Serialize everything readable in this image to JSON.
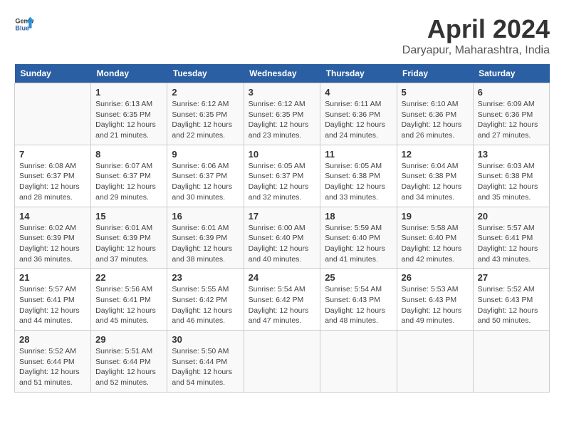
{
  "header": {
    "logo_general": "General",
    "logo_blue": "Blue",
    "month_title": "April 2024",
    "location": "Daryapur, Maharashtra, India"
  },
  "columns": [
    "Sunday",
    "Monday",
    "Tuesday",
    "Wednesday",
    "Thursday",
    "Friday",
    "Saturday"
  ],
  "weeks": [
    [
      {
        "day": "",
        "info": ""
      },
      {
        "day": "1",
        "info": "Sunrise: 6:13 AM\nSunset: 6:35 PM\nDaylight: 12 hours\nand 21 minutes."
      },
      {
        "day": "2",
        "info": "Sunrise: 6:12 AM\nSunset: 6:35 PM\nDaylight: 12 hours\nand 22 minutes."
      },
      {
        "day": "3",
        "info": "Sunrise: 6:12 AM\nSunset: 6:35 PM\nDaylight: 12 hours\nand 23 minutes."
      },
      {
        "day": "4",
        "info": "Sunrise: 6:11 AM\nSunset: 6:36 PM\nDaylight: 12 hours\nand 24 minutes."
      },
      {
        "day": "5",
        "info": "Sunrise: 6:10 AM\nSunset: 6:36 PM\nDaylight: 12 hours\nand 26 minutes."
      },
      {
        "day": "6",
        "info": "Sunrise: 6:09 AM\nSunset: 6:36 PM\nDaylight: 12 hours\nand 27 minutes."
      }
    ],
    [
      {
        "day": "7",
        "info": "Sunrise: 6:08 AM\nSunset: 6:37 PM\nDaylight: 12 hours\nand 28 minutes."
      },
      {
        "day": "8",
        "info": "Sunrise: 6:07 AM\nSunset: 6:37 PM\nDaylight: 12 hours\nand 29 minutes."
      },
      {
        "day": "9",
        "info": "Sunrise: 6:06 AM\nSunset: 6:37 PM\nDaylight: 12 hours\nand 30 minutes."
      },
      {
        "day": "10",
        "info": "Sunrise: 6:05 AM\nSunset: 6:37 PM\nDaylight: 12 hours\nand 32 minutes."
      },
      {
        "day": "11",
        "info": "Sunrise: 6:05 AM\nSunset: 6:38 PM\nDaylight: 12 hours\nand 33 minutes."
      },
      {
        "day": "12",
        "info": "Sunrise: 6:04 AM\nSunset: 6:38 PM\nDaylight: 12 hours\nand 34 minutes."
      },
      {
        "day": "13",
        "info": "Sunrise: 6:03 AM\nSunset: 6:38 PM\nDaylight: 12 hours\nand 35 minutes."
      }
    ],
    [
      {
        "day": "14",
        "info": "Sunrise: 6:02 AM\nSunset: 6:39 PM\nDaylight: 12 hours\nand 36 minutes."
      },
      {
        "day": "15",
        "info": "Sunrise: 6:01 AM\nSunset: 6:39 PM\nDaylight: 12 hours\nand 37 minutes."
      },
      {
        "day": "16",
        "info": "Sunrise: 6:01 AM\nSunset: 6:39 PM\nDaylight: 12 hours\nand 38 minutes."
      },
      {
        "day": "17",
        "info": "Sunrise: 6:00 AM\nSunset: 6:40 PM\nDaylight: 12 hours\nand 40 minutes."
      },
      {
        "day": "18",
        "info": "Sunrise: 5:59 AM\nSunset: 6:40 PM\nDaylight: 12 hours\nand 41 minutes."
      },
      {
        "day": "19",
        "info": "Sunrise: 5:58 AM\nSunset: 6:40 PM\nDaylight: 12 hours\nand 42 minutes."
      },
      {
        "day": "20",
        "info": "Sunrise: 5:57 AM\nSunset: 6:41 PM\nDaylight: 12 hours\nand 43 minutes."
      }
    ],
    [
      {
        "day": "21",
        "info": "Sunrise: 5:57 AM\nSunset: 6:41 PM\nDaylight: 12 hours\nand 44 minutes."
      },
      {
        "day": "22",
        "info": "Sunrise: 5:56 AM\nSunset: 6:41 PM\nDaylight: 12 hours\nand 45 minutes."
      },
      {
        "day": "23",
        "info": "Sunrise: 5:55 AM\nSunset: 6:42 PM\nDaylight: 12 hours\nand 46 minutes."
      },
      {
        "day": "24",
        "info": "Sunrise: 5:54 AM\nSunset: 6:42 PM\nDaylight: 12 hours\nand 47 minutes."
      },
      {
        "day": "25",
        "info": "Sunrise: 5:54 AM\nSunset: 6:43 PM\nDaylight: 12 hours\nand 48 minutes."
      },
      {
        "day": "26",
        "info": "Sunrise: 5:53 AM\nSunset: 6:43 PM\nDaylight: 12 hours\nand 49 minutes."
      },
      {
        "day": "27",
        "info": "Sunrise: 5:52 AM\nSunset: 6:43 PM\nDaylight: 12 hours\nand 50 minutes."
      }
    ],
    [
      {
        "day": "28",
        "info": "Sunrise: 5:52 AM\nSunset: 6:44 PM\nDaylight: 12 hours\nand 51 minutes."
      },
      {
        "day": "29",
        "info": "Sunrise: 5:51 AM\nSunset: 6:44 PM\nDaylight: 12 hours\nand 52 minutes."
      },
      {
        "day": "30",
        "info": "Sunrise: 5:50 AM\nSunset: 6:44 PM\nDaylight: 12 hours\nand 54 minutes."
      },
      {
        "day": "",
        "info": ""
      },
      {
        "day": "",
        "info": ""
      },
      {
        "day": "",
        "info": ""
      },
      {
        "day": "",
        "info": ""
      }
    ]
  ]
}
